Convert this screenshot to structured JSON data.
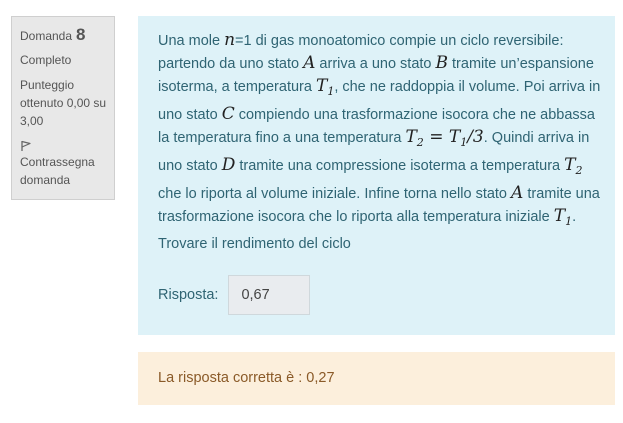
{
  "info": {
    "question_label": "Domanda",
    "question_number": "8",
    "state": "Completo",
    "grade_line1": "Punteggio",
    "grade_line2": "ottenuto 0,00 su",
    "grade_line3": "3,00",
    "flag_line1": "Contrassegna",
    "flag_line2": "domanda"
  },
  "question": {
    "t01": "Una mole ",
    "m01": "n",
    "t02": "=1 di gas monoatomico compie un ciclo reversibile: partendo da uno stato ",
    "m02": "A",
    "t03": " arriva a uno stato ",
    "m03": "B",
    "t04": " tramite un’espansione isoterma, a temperatura ",
    "m04": "T",
    "s04": "1",
    "t05": ", che ne raddoppia il volume. Poi arriva in uno stato ",
    "m05": "C",
    "t06": " compiendo una trasformazione isocora che ne abbassa la temperatura fino a una temperatura ",
    "m06": "T",
    "s06": "2",
    "m07": " = T",
    "s07": "1",
    "m08": "/3",
    "t08": ". Quindi arriva in uno stato ",
    "m09": "D",
    "t09": " tramite una compressione isoterma a temperatura ",
    "m10": "T",
    "s10": "2",
    "t10": " che lo riporta al volume iniziale. Infine torna nello stato ",
    "m11": "A",
    "t11": " tramite una trasformazione isocora che lo riporta alla temperatura iniziale ",
    "m12": "T",
    "s12": "1",
    "t12": ". Trovare il rendimento del ciclo"
  },
  "answer": {
    "label": "Risposta:",
    "value": "0,67"
  },
  "feedback": {
    "text": "La risposta corretta è : 0,27"
  }
}
